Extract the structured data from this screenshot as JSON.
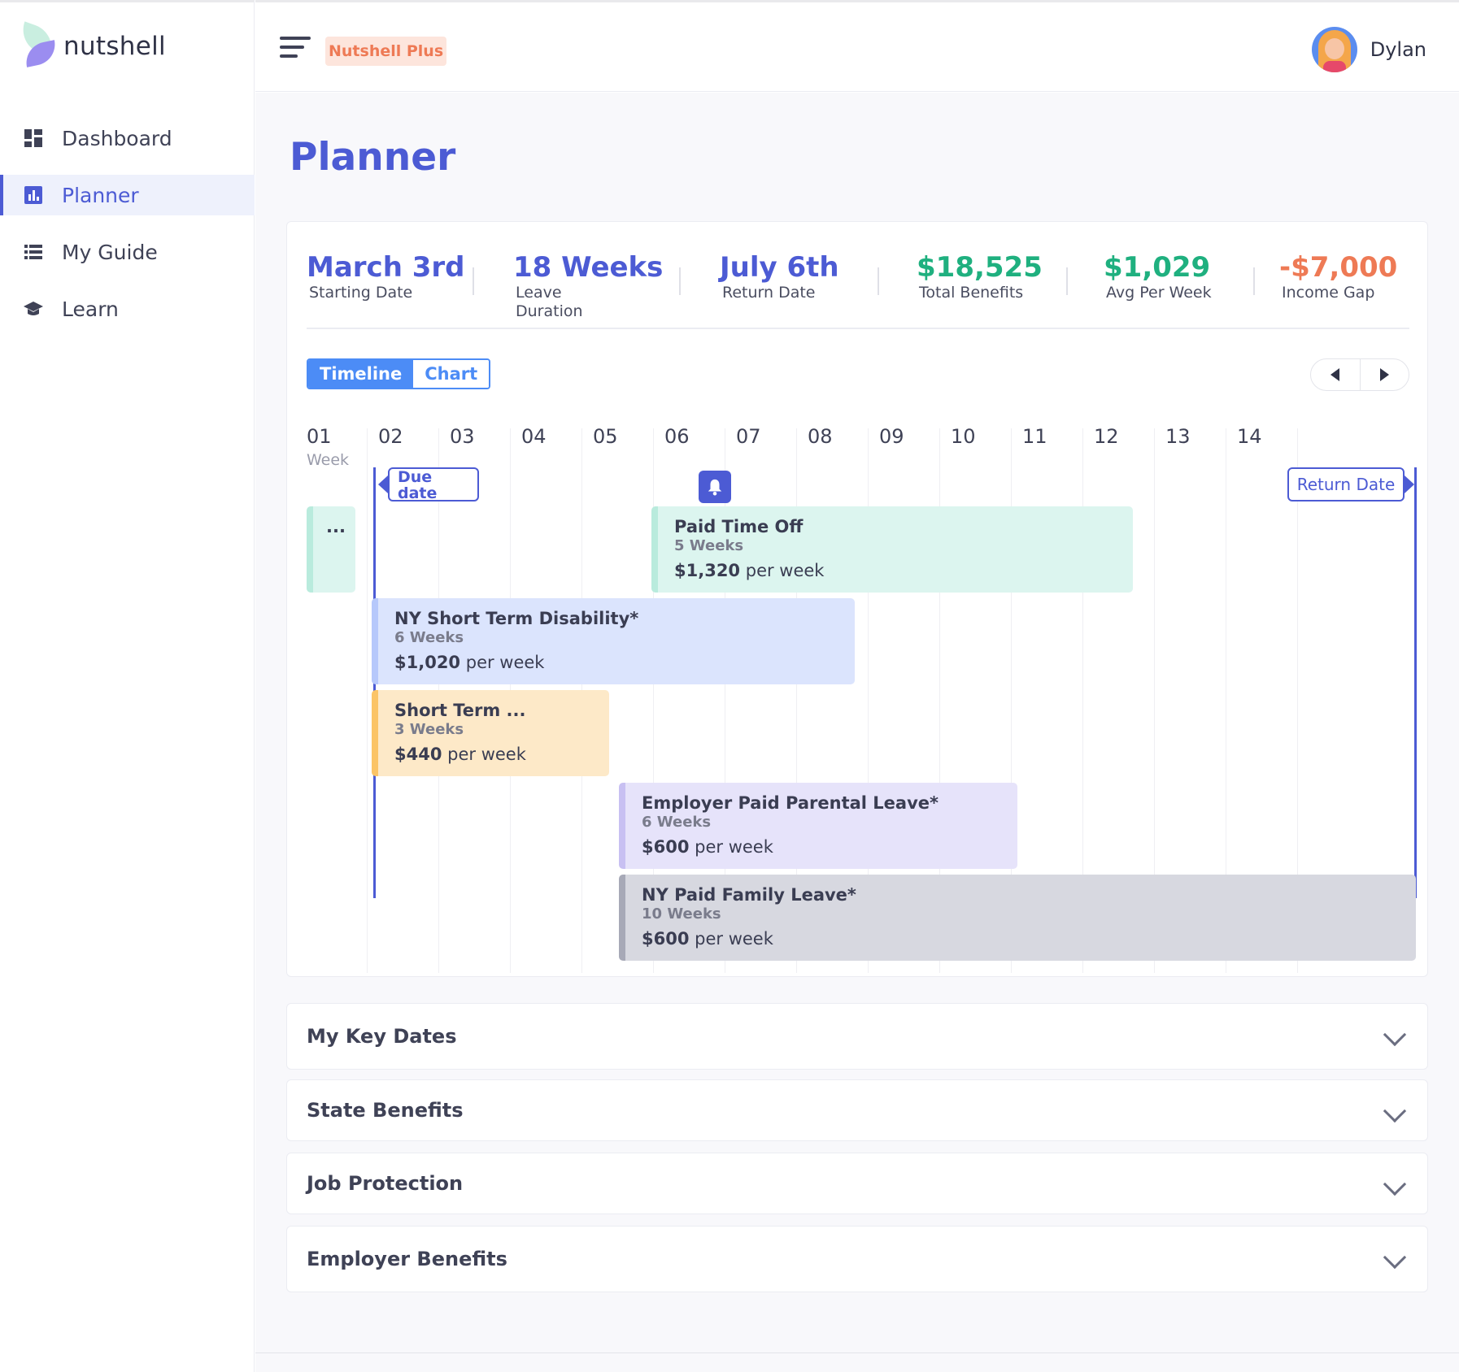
{
  "app": {
    "name": "nutshell",
    "plan_badge": "Nutshell Plus"
  },
  "user": {
    "name": "Dylan"
  },
  "sidebar": {
    "items": [
      {
        "label": "Dashboard",
        "icon": "dashboard-icon",
        "active": false
      },
      {
        "label": "Planner",
        "icon": "chart-icon",
        "active": true
      },
      {
        "label": "My Guide",
        "icon": "list-icon",
        "active": false
      },
      {
        "label": "Learn",
        "icon": "graduation-cap-icon",
        "active": false
      }
    ]
  },
  "page": {
    "title": "Planner"
  },
  "stats": [
    {
      "value": "March 3rd",
      "label": "Starting Date",
      "color": "#4c5bd4"
    },
    {
      "value": "18 Weeks",
      "label": "Leave Duration",
      "color": "#4c5bd4"
    },
    {
      "value": "July 6th",
      "label": "Return Date",
      "color": "#4c5bd4"
    },
    {
      "value": "$18,525",
      "label": "Total Benefits",
      "color": "#1fb07f"
    },
    {
      "value": "$1,029",
      "label": "Avg Per Week",
      "color": "#1fb07f"
    },
    {
      "value": "-$7,000",
      "label": "Income Gap",
      "color": "#ee7a55"
    }
  ],
  "view_toggle": {
    "timeline": "Timeline",
    "chart": "Chart",
    "selected": "Timeline"
  },
  "timeline": {
    "week_sub_label": "Week",
    "weeks": [
      "01",
      "02",
      "03",
      "04",
      "05",
      "06",
      "07",
      "08",
      "09",
      "10",
      "11",
      "12",
      "13",
      "14"
    ],
    "due_date_label": "Due date",
    "return_date_label": "Return Date",
    "overflow_label": "...",
    "bars": [
      {
        "title": "Paid Time Off",
        "weeks": "5 Weeks",
        "amount": "$1,320",
        "per": "per week",
        "color": "green"
      },
      {
        "title": "NY Short Term Disability*",
        "weeks": "6 Weeks",
        "amount": "$1,020",
        "per": "per week",
        "color": "blue"
      },
      {
        "title": "Short Term ...",
        "weeks": "3 Weeks",
        "amount": "$440",
        "per": "per week",
        "color": "orange"
      },
      {
        "title": "Employer Paid Parental Leave*",
        "weeks": "6 Weeks",
        "amount": "$600",
        "per": "per week",
        "color": "purple"
      },
      {
        "title": "NY Paid Family Leave*",
        "weeks": "10 Weeks",
        "amount": "$600",
        "per": "per week",
        "color": "gray"
      }
    ]
  },
  "sections": [
    {
      "title": "My Key Dates"
    },
    {
      "title": "State Benefits"
    },
    {
      "title": "Job Protection"
    },
    {
      "title": "Employer Benefits"
    }
  ]
}
